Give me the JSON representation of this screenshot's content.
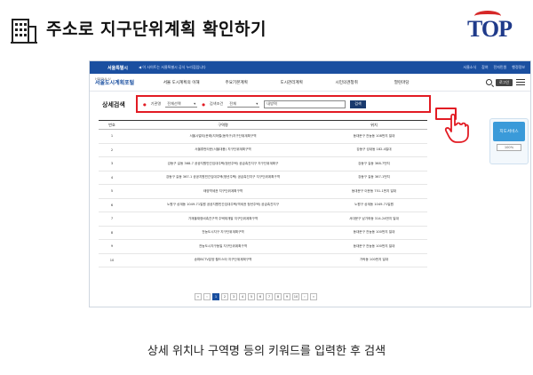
{
  "slide": {
    "title": "주소로 지구단위계획 확인하기",
    "logo_text": "TOP",
    "caption": "상세 위치나 구역명 등의 키워드를 입력한 후 검색",
    "accent": "#e21b23",
    "brand_blue": "#1a4fa0"
  },
  "site": {
    "topbar": {
      "logo": "서울특별시",
      "notice": "◀ 이 사이트는 서울특별시 공식 누리집입니다",
      "links": [
        "서울소식",
        "참여",
        "전자민원",
        "행정정보"
      ]
    },
    "brand_small": "I·SEOUL·U",
    "brand_big": "서울도시계획포털",
    "menu": [
      "서울 도시계획의 이해",
      "주요기본계획",
      "도시관리계획",
      "시민의견청취",
      "열린마당"
    ],
    "login_label": "로그인"
  },
  "search": {
    "section_title": "상세검색",
    "label1": "기관명",
    "select1": "전체선택",
    "label2": "검색조건",
    "select2": "전체",
    "keyword": "내방역",
    "button": "검색"
  },
  "map_service": {
    "label": "지도서비스",
    "zoom": "100%"
  },
  "table": {
    "headers": [
      "번호",
      "구역명",
      "위치"
    ],
    "rows": [
      [
        "1",
        "서울시멀티(문래)지하철(동작구)지구단위계획구역",
        "동대문구 전농동 108번지 일대"
      ],
      [
        "2",
        "서울휴먼타운(서울대용) 지구단위계획구역",
        "강동구 성내동 182-4일대"
      ],
      [
        "3",
        "강동구 길동 368-7 공공지원민간임대주택(청년주택) 공급촉진지구 지구단위계획구",
        "강동구 길동 368-7번지"
      ],
      [
        "4",
        "강동구 길동 367-1 공공지원민간임대주택(청년주택) 공급촉진지구 지구단위계획구역",
        "강동구 길동 367-1번지"
      ],
      [
        "5",
        "태양역세권 지구단위계획구역",
        "동대문구 이문동 751-1번지 일대"
      ],
      [
        "6",
        "노원구 상계동 1049-71일원 공공지원민간임대주택(역세권 청년주택) 공급촉진지구",
        "노원구 상계동 1049-71일원"
      ],
      [
        "7",
        "가재울재정비촉진구역 주택재개발 지구단위계획구역",
        "서대문구 남가좌동 314-24번지 일대"
      ],
      [
        "8",
        "전농도시지구 지구단위계획구역",
        "동대문구 전농동 100번지 일대"
      ],
      [
        "9",
        "전농도시지구동일 지구단위계획구역",
        "동대문구 전농동 100번지 일대"
      ],
      [
        "10",
        "송파BCTV분양 월드스타 지구단위계획구역",
        "가락동 100번지 일대"
      ]
    ]
  },
  "pager": [
    "«",
    "‹",
    "1",
    "2",
    "3",
    "4",
    "5",
    "6",
    "7",
    "8",
    "9",
    "10",
    "›",
    "»"
  ]
}
